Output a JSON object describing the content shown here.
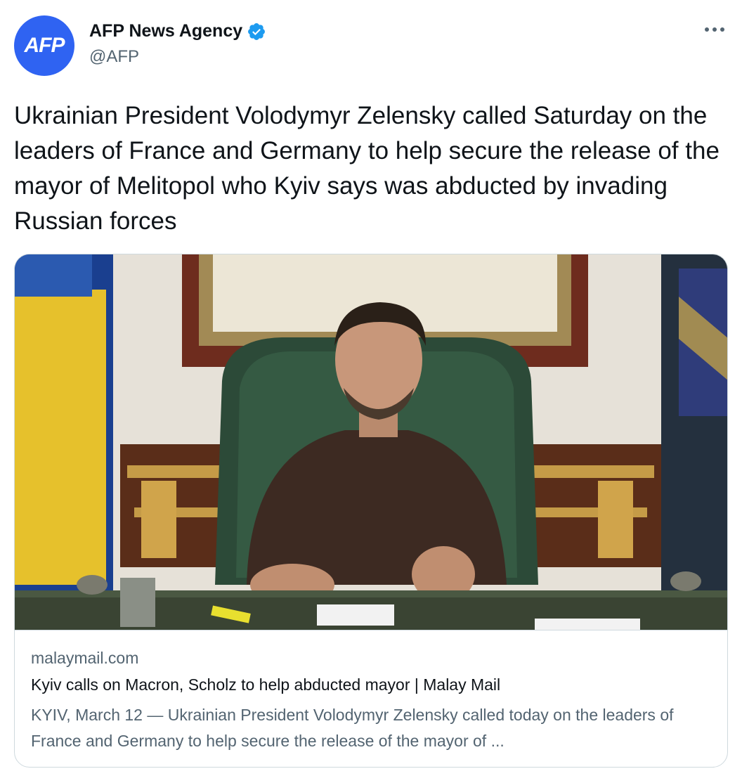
{
  "author": {
    "avatar_text": "AFP",
    "name": "AFP News Agency",
    "handle": "@AFP",
    "verified": true
  },
  "more_icon": "more-horizontal-icon",
  "tweet": {
    "text": "Ukrainian President Volodymyr Zelensky called Saturday on the leaders of France and Germany to help secure the release of the mayor of Melitopol who Kyiv says was abducted by invading Russian forces"
  },
  "link_card": {
    "domain": "malaymail.com",
    "title": "Kyiv calls on Macron, Scholz to help abducted mayor | Malay Mail",
    "description": "KYIV, March 12 — Ukrainian President Volodymyr Zelensky called today on the leaders of France and Germany to help secure the release of the mayor of ..."
  },
  "colors": {
    "avatar_bg": "#2f63f2",
    "verified_blue": "#1d9bf0",
    "secondary_text": "#536471",
    "border": "#cfd9de"
  }
}
